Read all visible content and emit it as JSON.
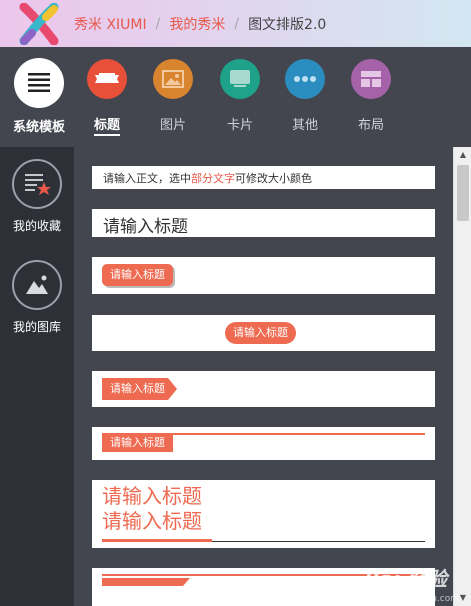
{
  "header": {
    "breadcrumbs": [
      "秀米 XIUMI",
      "我的秀米",
      "图文排版2.0"
    ],
    "separator": "/"
  },
  "toolbar": {
    "system_templates": "系统模板",
    "tabs": [
      {
        "label": "标题",
        "icon": "ribbon-icon",
        "color": "#e8503a",
        "active": true
      },
      {
        "label": "图片",
        "icon": "image-icon",
        "color": "#d9842f",
        "active": false
      },
      {
        "label": "卡片",
        "icon": "card-icon",
        "color": "#1fa28a",
        "active": false
      },
      {
        "label": "其他",
        "icon": "more-icon",
        "color": "#2b8cbf",
        "active": false
      },
      {
        "label": "布局",
        "icon": "layout-icon",
        "color": "#a562a8",
        "active": false
      }
    ]
  },
  "sidebar": {
    "items": [
      {
        "label": "我的收藏",
        "icon": "favorites-icon"
      },
      {
        "label": "我的图库",
        "icon": "gallery-icon"
      }
    ]
  },
  "content": {
    "body_text": {
      "prefix": "请输入正文，选中",
      "highlight": "部分文字",
      "suffix": "可修改大小颜色"
    },
    "title_1": "请输入标题",
    "title_2": "请输入标题",
    "title_3": "请输入标题",
    "title_4": "请输入标题",
    "title_5": "请输入标题",
    "title_6_line1": "请输入标题",
    "title_6_line2": "请输入标题"
  },
  "colors": {
    "accent": "#ee6a50",
    "dark_bg": "#43464f",
    "sidebar_bg": "#2e3038"
  },
  "watermark": {
    "text": "Bai 经验",
    "sub": "jingyan.baidu.com"
  }
}
